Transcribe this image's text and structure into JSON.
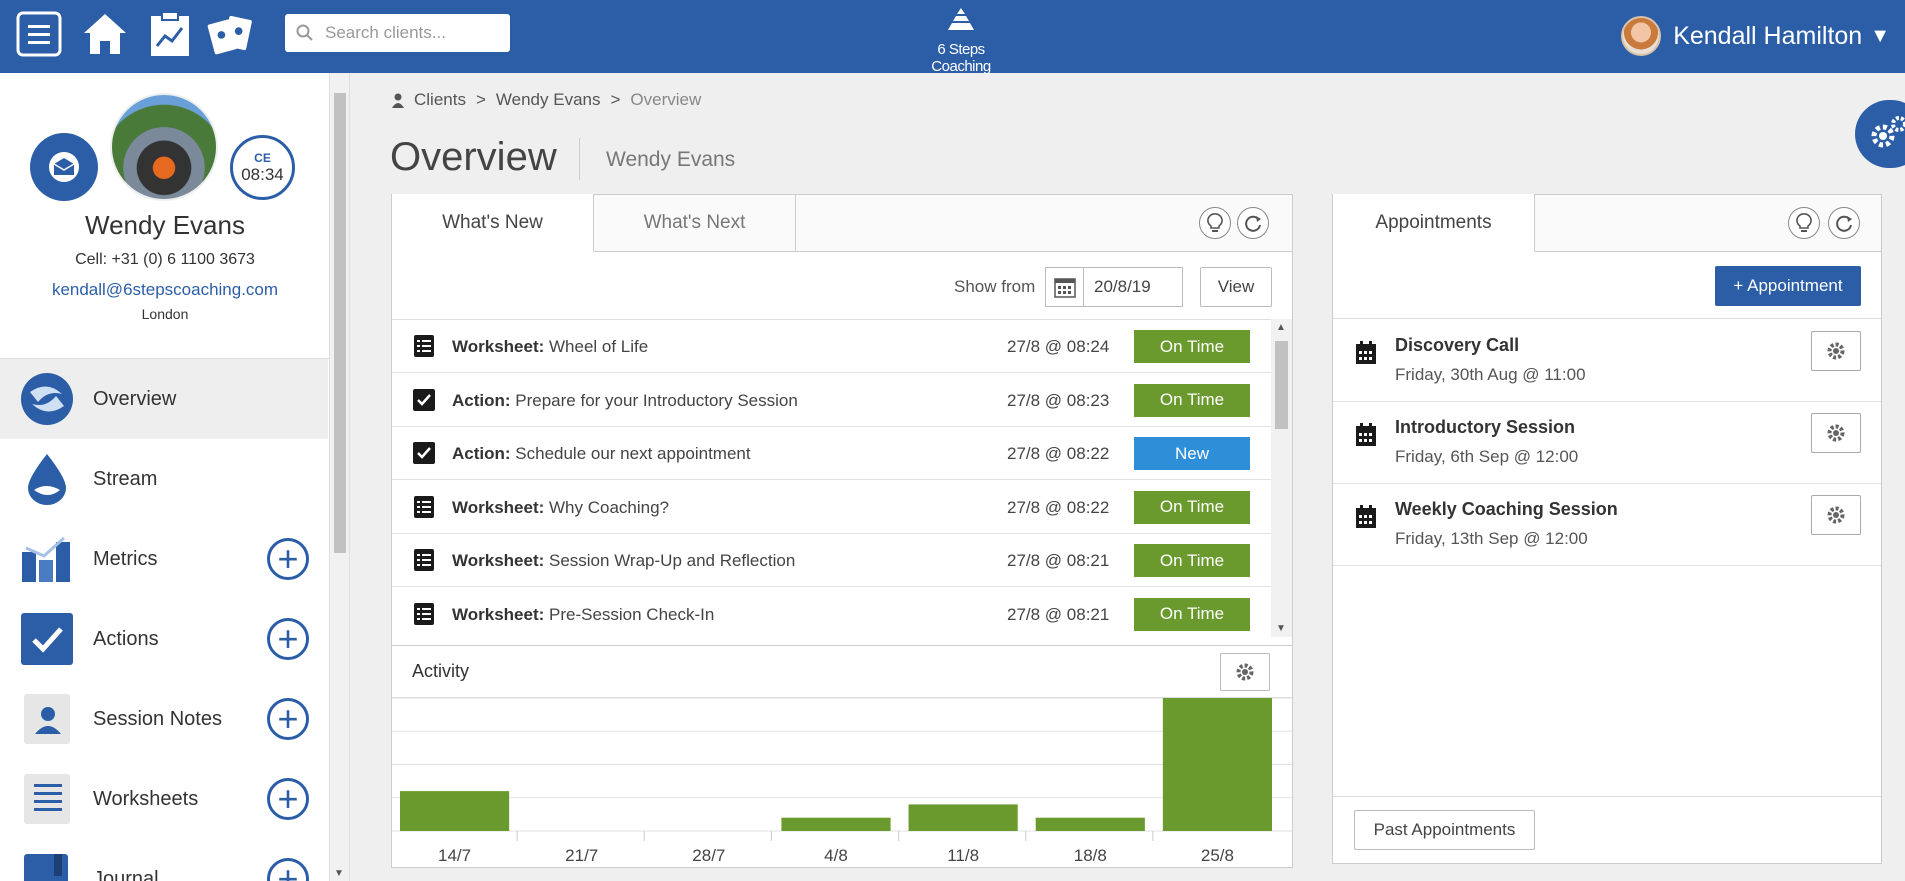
{
  "header": {
    "search_placeholder": "Search clients...",
    "brand": "6 Steps Coaching",
    "user_name": "Kendall Hamilton",
    "caret": "▼"
  },
  "profile": {
    "name": "Wendy Evans",
    "cell": "Cell:  +31 (0) 6 1100 3673",
    "email": "kendall@6stepscoaching.com",
    "location": "London",
    "ce_label": "CE",
    "ce_time": "08:34"
  },
  "sidebar": {
    "items": [
      {
        "label": "Overview"
      },
      {
        "label": "Stream"
      },
      {
        "label": "Metrics"
      },
      {
        "label": "Actions"
      },
      {
        "label": "Session Notes"
      },
      {
        "label": "Worksheets"
      },
      {
        "label": "Journal"
      }
    ],
    "plus": "+"
  },
  "breadcrumb": {
    "items": [
      "Clients",
      "Wendy Evans",
      "Overview"
    ],
    "sep": ">"
  },
  "page": {
    "title": "Overview",
    "subtitle": "Wendy Evans"
  },
  "whats_panel": {
    "tabs": [
      "What's New",
      "What's Next"
    ],
    "show_from_label": "Show from",
    "date_value": "20/8/19",
    "view_label": "View",
    "rows": [
      {
        "type": "Worksheet:",
        "text": " Wheel of Life",
        "time": "27/8 @ 08:24",
        "status": "On Time",
        "icon": "worksheet-icon"
      },
      {
        "type": "Action:",
        "text": " Prepare for your Introductory Session",
        "time": "27/8 @ 08:23",
        "status": "On Time",
        "icon": "checkbox-icon"
      },
      {
        "type": "Action:",
        "text": " Schedule our next appointment",
        "time": "27/8 @ 08:22",
        "status": "New",
        "icon": "checkbox-icon"
      },
      {
        "type": "Worksheet:",
        "text": " Why Coaching?",
        "time": "27/8 @ 08:22",
        "status": "On Time",
        "icon": "worksheet-icon"
      },
      {
        "type": "Worksheet:",
        "text": " Session Wrap-Up and Reflection",
        "time": "27/8 @ 08:21",
        "status": "On Time",
        "icon": "worksheet-icon"
      },
      {
        "type": "Worksheet:",
        "text": " Pre-Session Check-In",
        "time": "27/8 @ 08:21",
        "status": "On Time",
        "icon": "worksheet-icon"
      }
    ],
    "status_colors": {
      "On Time": "#6a9a2e",
      "New": "#2e8fd8"
    }
  },
  "activity": {
    "label": "Activity"
  },
  "chart_data": {
    "type": "bar",
    "categories": [
      "14/7",
      "21/7",
      "28/7",
      "4/8",
      "11/8",
      "18/8",
      "25/8"
    ],
    "values": [
      3,
      0,
      0,
      1,
      2,
      1,
      10
    ],
    "ylim": [
      0,
      10
    ],
    "grid": true,
    "color": "#6a9a2e"
  },
  "appointments": {
    "tab": "Appointments",
    "add_label": "+ Appointment",
    "items": [
      {
        "title": "Discovery Call",
        "date": "Friday, 30th Aug @ 11:00"
      },
      {
        "title": "Introductory Session",
        "date": "Friday, 6th Sep @ 12:00"
      },
      {
        "title": "Weekly Coaching Session",
        "date": "Friday, 13th Sep @ 12:00"
      }
    ],
    "past_label": "Past Appointments"
  },
  "colors": {
    "brand": "#2c5ea8",
    "ontime": "#6a9a2e",
    "new": "#2e8fd8"
  }
}
